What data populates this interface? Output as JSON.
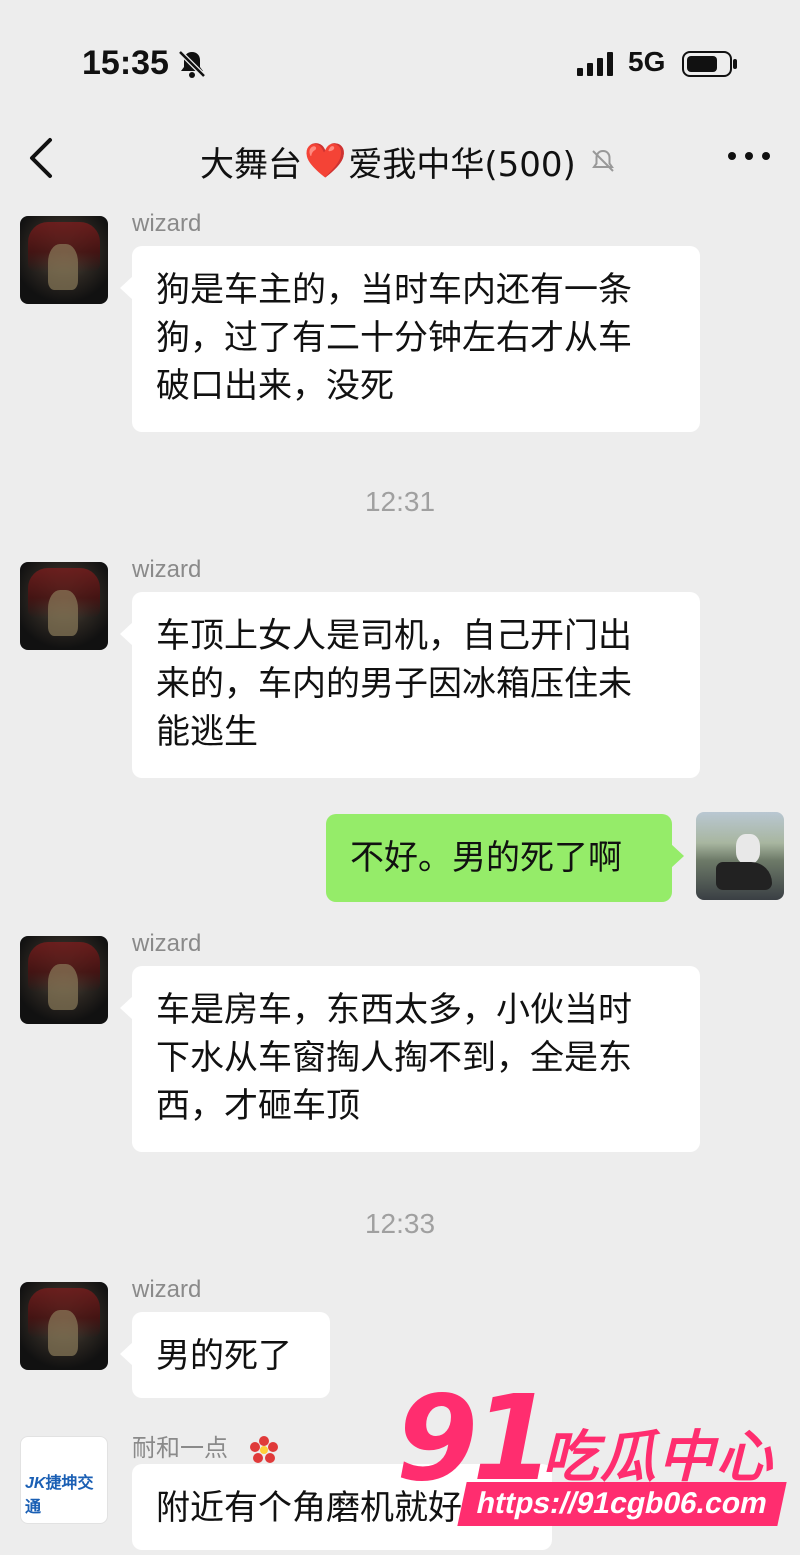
{
  "status_bar": {
    "time": "15:35",
    "network": "5G",
    "icons": [
      "bell-muted-icon",
      "signal-icon",
      "battery-icon"
    ]
  },
  "nav": {
    "title_prefix": "大舞台",
    "title_heart": "❤️",
    "title_suffix": "爱我中华(500)",
    "icons": [
      "back-chevron-icon",
      "muted-icon",
      "more-icon"
    ]
  },
  "messages": [
    {
      "sender": "wizard",
      "text": "狗是车主的，当时车内还有一条狗，过了有二十分钟左右才从车破口出来，没死",
      "lines": [
        "狗是车主的，当时车内还有一条",
        "狗，过了有二十分钟左右才从车",
        "破口出来，没死"
      ]
    },
    {
      "timestamp": "12:31"
    },
    {
      "sender": "wizard",
      "lines": [
        "车顶上女人是司机，自己开门出",
        "来的，车内的男子因冰箱压住未",
        "能逃生"
      ]
    },
    {
      "sender": "self",
      "lines": [
        "不好。男的死了啊"
      ]
    },
    {
      "sender": "wizard",
      "lines": [
        "车是房车，东西太多，小伙当时",
        "下水从车窗掏人掏不到，全是东",
        "西，才砸车顶"
      ]
    },
    {
      "timestamp": "12:33"
    },
    {
      "sender": "wizard",
      "lines": [
        "男的死了"
      ]
    },
    {
      "sender": "耐和一点",
      "lines": [
        "附近有个角磨机就好"
      ]
    }
  ],
  "logo_text": {
    "mark": "JK",
    "name": "捷坤交通"
  },
  "watermark": {
    "brand_num": "91",
    "brand_cn": "吃瓜中心",
    "url": "https://91cgb06.com"
  },
  "colors": {
    "background": "#ededed",
    "bubble_in": "#ffffff",
    "bubble_out": "#95ec69",
    "watermark": "#ff2d6f"
  }
}
